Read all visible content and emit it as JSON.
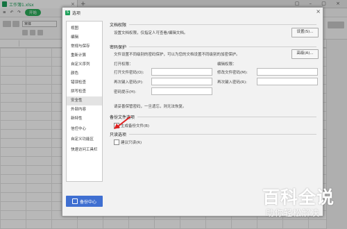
{
  "app": {
    "tab_title": "工作簿1.xlsx",
    "menu_start": "开始",
    "font_name": "宋体"
  },
  "dialog": {
    "title": "选项",
    "close": "×",
    "nav": [
      "视图",
      "编辑",
      "常规与保存",
      "重新计算",
      "自定义序列",
      "颜色",
      "错误检查",
      "拼写检查",
      "安全性",
      "外部内容",
      "新特性",
      "信任中心",
      "自定义功能区",
      "快速访问工具栏"
    ],
    "active_nav": "安全性",
    "backup_center": "备份中心",
    "doc_perm": {
      "heading": "文档权限",
      "desc": "设置文档权限，仅指定人可查看/编辑文档。",
      "button": "设置(S)..."
    },
    "pwd_protect": {
      "heading": "密码保护",
      "desc": "文件设置不同级别的密码保护，可以为您的文档设置不同级别的加密保护。",
      "button": "高级(A)...",
      "open_perm": "打开权限：",
      "edit_perm": "编辑权限：",
      "open_pwd_label": "打开文件密码(O):",
      "open_reenter_label": "再次键入密码(P):",
      "pwd_hint_label": "密码提示(H):",
      "edit_pwd_label": "修改文件密码(M):",
      "edit_reenter_label": "再次键入密码(R):",
      "notice": "请妥善保管密码，一旦遗忘，则无法恢复。"
    },
    "backup": {
      "heading": "备份文件选项",
      "checkbox": "生成备份文件(B)",
      "checked": false
    },
    "readonly": {
      "heading": "只读选项",
      "checkbox": "建议只读(R)",
      "checked": false
    }
  },
  "watermark": {
    "line1": "百科全说",
    "line2": "助你轻松解决"
  },
  "colors": {
    "brand_green": "#1ea05a",
    "active_nav_bg": "#e3e3e3",
    "backup_button": "#3f6fd1",
    "arrow": "#e02020"
  }
}
